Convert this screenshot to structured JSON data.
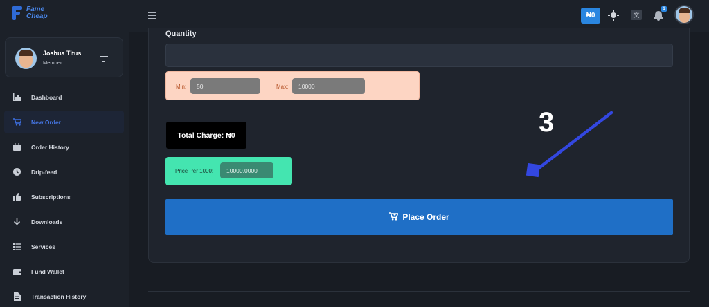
{
  "brand": {
    "line1": "Fame",
    "line2": "Cheap"
  },
  "user": {
    "name": "Joshua Titus",
    "role": "Member"
  },
  "sidebar": {
    "items": [
      {
        "label": "Dashboard",
        "icon": "chart-icon",
        "active": false
      },
      {
        "label": "New Order",
        "icon": "cart-icon",
        "active": true
      },
      {
        "label": "Order History",
        "icon": "calendar-icon",
        "active": false
      },
      {
        "label": "Drip-feed",
        "icon": "clock-icon",
        "active": false
      },
      {
        "label": "Subscriptions",
        "icon": "thumbs-up-icon",
        "active": false
      },
      {
        "label": "Downloads",
        "icon": "download-arrow-icon",
        "active": false
      },
      {
        "label": "Services",
        "icon": "list-icon",
        "active": false
      },
      {
        "label": "Fund Wallet",
        "icon": "wallet-icon",
        "active": false
      },
      {
        "label": "Transaction History",
        "icon": "document-icon",
        "active": false
      }
    ]
  },
  "topbar": {
    "balance": "₦0",
    "notification_count": "1"
  },
  "form": {
    "quantity_label": "Quantity",
    "quantity_value": "",
    "min_label": "Min:",
    "min_value": "50",
    "max_label": "Max:",
    "max_value": "10000",
    "total_charge": "Total Charge: ₦0",
    "price_per_1000_label": "Price Per 1000:",
    "price_per_1000_value": "10000.0000",
    "place_order_label": "Place Order"
  },
  "annotation": {
    "step_number": "3"
  },
  "colors": {
    "accent": "#1f6fc6",
    "balance_badge": "#2a86e0",
    "minmax_bg": "#fdd5c3",
    "price_bg": "#44e5b0",
    "annotation_arrow": "#3347e0"
  }
}
